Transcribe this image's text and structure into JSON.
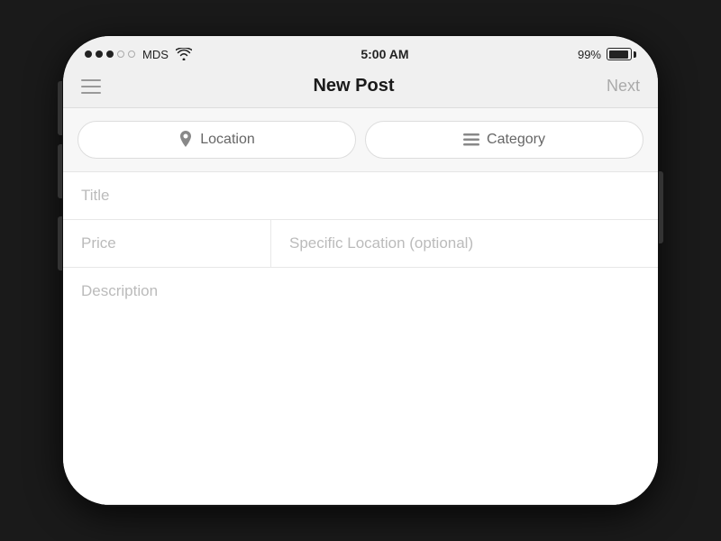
{
  "status_bar": {
    "carrier": "MDS",
    "time": "5:00 AM",
    "battery_pct": "99%"
  },
  "nav": {
    "title": "New Post",
    "next_label": "Next"
  },
  "filters": {
    "location_label": "Location",
    "category_label": "Category"
  },
  "form": {
    "title_placeholder": "Title",
    "price_placeholder": "Price",
    "specific_location_placeholder": "Specific Location (optional)",
    "description_placeholder": "Description"
  }
}
